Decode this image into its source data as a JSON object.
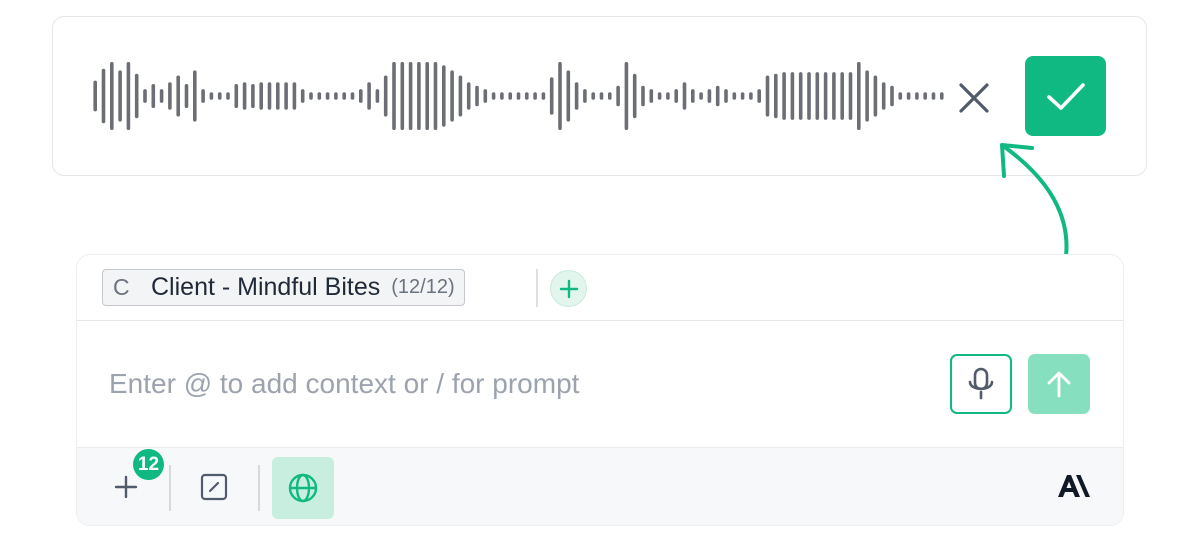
{
  "recorder": {
    "waveform_levels": [
      0.4,
      0.75,
      0.95,
      0.7,
      0.95,
      0.6,
      0.15,
      0.3,
      0.15,
      0.35,
      0.55,
      0.3,
      0.7,
      0.15,
      0.06,
      0.06,
      0.06,
      0.3,
      0.35,
      0.3,
      0.35,
      0.35,
      0.35,
      0.35,
      0.35,
      0.15,
      0.06,
      0.06,
      0.06,
      0.06,
      0.06,
      0.06,
      0.15,
      0.35,
      0.15,
      0.55,
      0.95,
      0.95,
      0.95,
      0.95,
      0.95,
      0.95,
      0.85,
      0.7,
      0.55,
      0.35,
      0.25,
      0.15,
      0.06,
      0.06,
      0.06,
      0.06,
      0.06,
      0.06,
      0.06,
      0.5,
      0.95,
      0.7,
      0.35,
      0.15,
      0.06,
      0.06,
      0.06,
      0.25,
      0.95,
      0.6,
      0.25,
      0.15,
      0.06,
      0.06,
      0.15,
      0.35,
      0.15,
      0.06,
      0.15,
      0.25,
      0.15,
      0.06,
      0.06,
      0.06,
      0.15,
      0.55,
      0.6,
      0.65,
      0.65,
      0.65,
      0.65,
      0.65,
      0.65,
      0.65,
      0.65,
      0.65,
      0.95,
      0.7,
      0.55,
      0.35,
      0.25,
      0.06,
      0.06,
      0.06,
      0.06,
      0.06,
      0.06
    ],
    "cancel_icon": "close-icon",
    "confirm_icon": "check-icon",
    "accent_color": "#10b981"
  },
  "context": {
    "chip_letter": "C",
    "chip_name": "Client - Mindful Bites",
    "chip_count": "(12/12)",
    "add_icon": "plus-circle-icon"
  },
  "input": {
    "placeholder": "Enter @ to add context or / for prompt",
    "mic_icon": "microphone-icon",
    "send_icon": "arrow-up-icon"
  },
  "toolbar": {
    "badge_count": "12",
    "plus_icon": "plus-icon",
    "edit_icon": "edit-square-icon",
    "globe_icon": "globe-icon",
    "brand_icon": "anthropic-logo-icon"
  }
}
